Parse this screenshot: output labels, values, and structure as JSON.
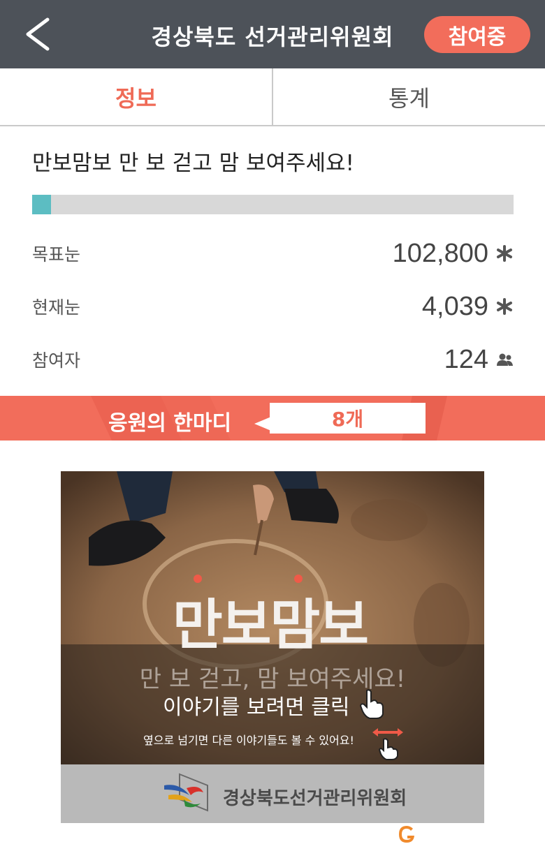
{
  "header": {
    "title": "경상북도 선거관리위원회",
    "join_label": "참여중"
  },
  "tabs": [
    {
      "label": "정보",
      "active": true
    },
    {
      "label": "통계",
      "active": false
    }
  ],
  "campaign": {
    "title": "만보맘보 만 보 걷고 맘 보여주세요!",
    "progress_percent": 3.9
  },
  "stats": {
    "target": {
      "label": "목표눈",
      "value": "102,800",
      "icon": "snowflake-icon"
    },
    "current": {
      "label": "현재눈",
      "value": "4,039",
      "icon": "snowflake-icon"
    },
    "participants": {
      "label": "참여자",
      "value": "124",
      "icon": "people-icon"
    }
  },
  "cheer": {
    "label": "응원의 한마디",
    "count": "8개"
  },
  "story": {
    "logo_text": "만보맘보",
    "slogan": "만 보 걷고, 맘 보여주세요!",
    "cta": "이야기를 보려면 클릭",
    "hint": "옆으로 넘기면 다른 이야기들도 볼 수 있어요!",
    "org_name": "경상북도선거관리위원회"
  },
  "colors": {
    "header_bg": "#4d5259",
    "accent": "#f26d5b",
    "progress": "#5cbdc2"
  }
}
